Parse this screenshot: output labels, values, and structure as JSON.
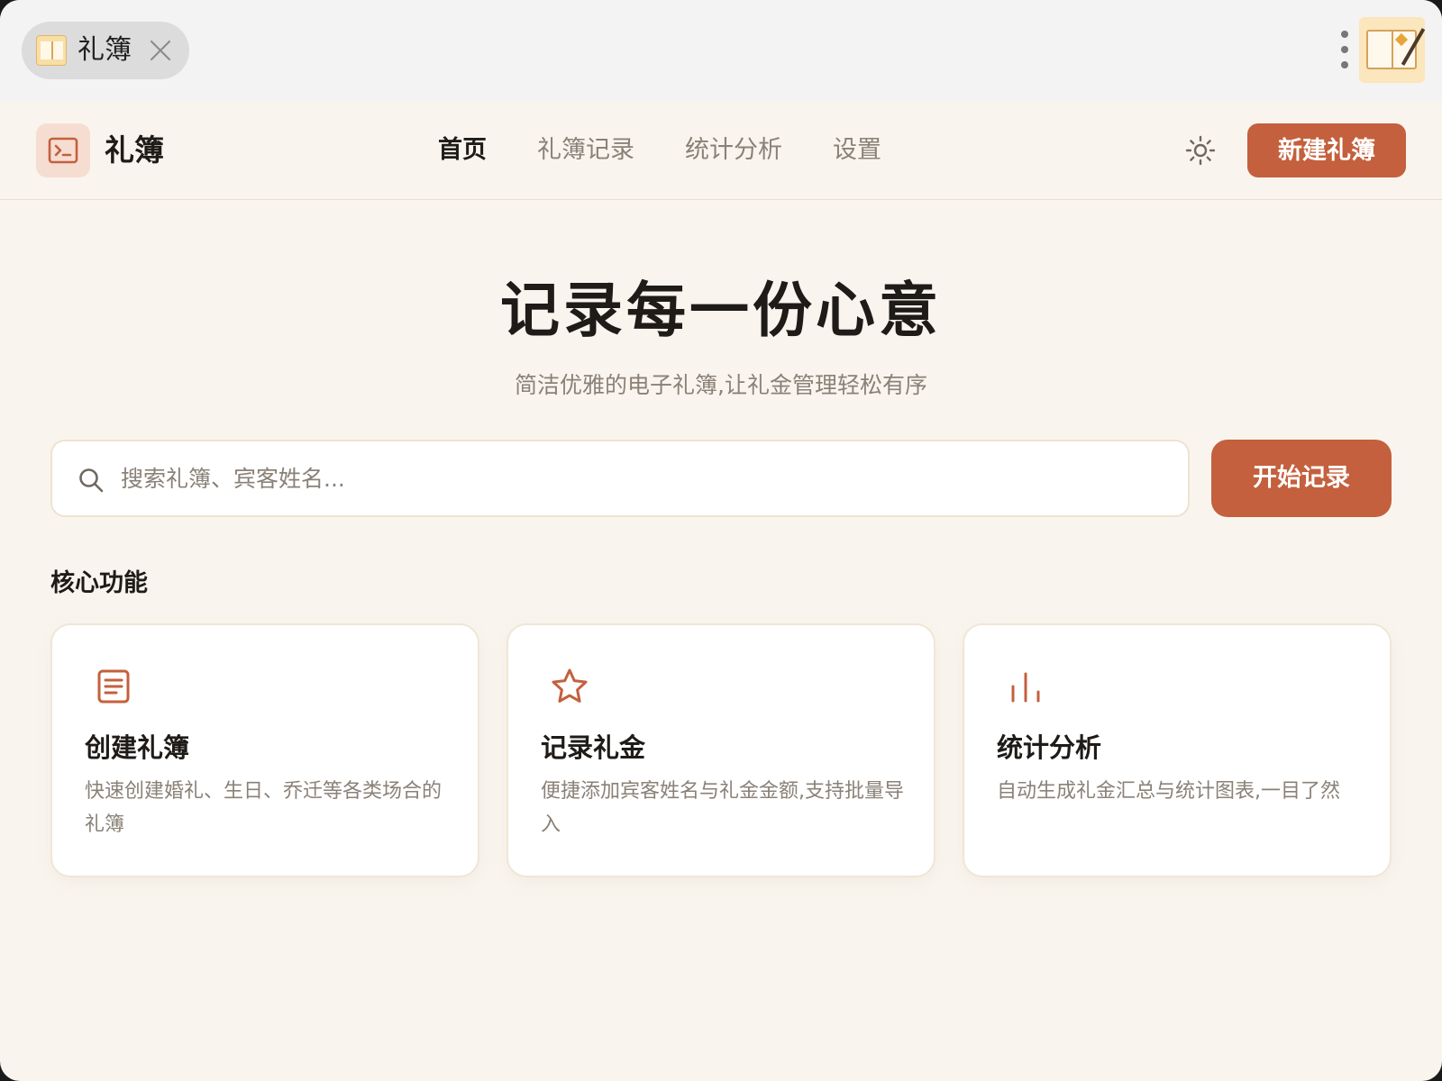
{
  "tabbar": {
    "tab_label": "礼簿"
  },
  "header": {
    "brand": "礼簿",
    "nav": [
      {
        "label": "首页"
      },
      {
        "label": "礼簿记录"
      },
      {
        "label": "统计分析"
      },
      {
        "label": "设置"
      }
    ],
    "active_nav": "首页",
    "new_button": "新建礼簿"
  },
  "hero": {
    "title": "记录每一份心意",
    "subtitle": "简洁优雅的电子礼簿,让礼金管理轻松有序"
  },
  "search": {
    "placeholder": "搜索礼簿、宾客姓名...",
    "button": "开始记录"
  },
  "features": {
    "title": "核心功能",
    "cards": [
      {
        "icon": "document-list-icon",
        "title": "创建礼簿",
        "desc": "快速创建婚礼、生日、乔迁等各类场合的礼簿"
      },
      {
        "icon": "star-icon",
        "title": "记录礼金",
        "desc": "便捷添加宾客姓名与礼金金额,支持批量导入"
      },
      {
        "icon": "bar-chart-icon",
        "title": "统计分析",
        "desc": "自动生成礼金汇总与统计图表,一目了然"
      }
    ]
  },
  "colors": {
    "accent": "#c4603d",
    "background": "#f9f5ee",
    "text_primary": "#1e1b18",
    "text_muted": "#8a8177"
  }
}
